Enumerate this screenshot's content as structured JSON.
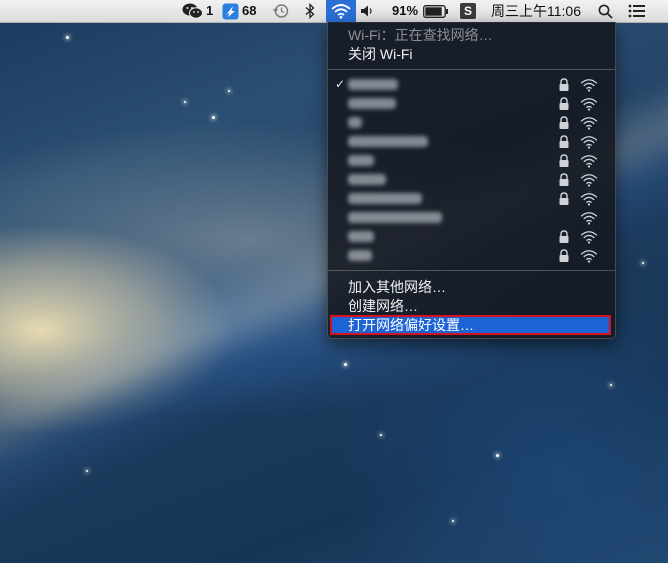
{
  "menubar": {
    "wechat": {
      "icon": "wechat-icon",
      "count": "1"
    },
    "app_badge": {
      "icon": "app-update-icon",
      "count": "68"
    },
    "time_machine_icon": "time-machine-icon",
    "bluetooth_icon": "bluetooth-icon",
    "wifi_icon": "wifi-icon",
    "volume_icon": "volume-icon",
    "battery": {
      "percent": "91%",
      "icon": "battery-icon",
      "level": 0.91
    },
    "input_method": {
      "icon": "input-method-icon",
      "label": "S"
    },
    "clock": "周三上午11:06",
    "spotlight_icon": "spotlight-search-icon",
    "notification_icon": "notification-center-icon"
  },
  "wifi_menu": {
    "status": "Wi-Fi：正在查找网络…",
    "toggle": "关闭 Wi-Fi",
    "networks": [
      {
        "locked": true,
        "connected": true
      },
      {
        "locked": true,
        "connected": false
      },
      {
        "locked": true,
        "connected": false
      },
      {
        "locked": true,
        "connected": false
      },
      {
        "locked": true,
        "connected": false
      },
      {
        "locked": true,
        "connected": false
      },
      {
        "locked": true,
        "connected": false
      },
      {
        "locked": false,
        "connected": false
      },
      {
        "locked": true,
        "connected": false
      },
      {
        "locked": true,
        "connected": false
      }
    ],
    "join_other": "加入其他网络…",
    "create": "创建网络…",
    "open_prefs": "打开网络偏好设置…"
  },
  "colors": {
    "highlight": "#1c64d6",
    "annotation_border": "#d6121f",
    "menubar_active": "#2a6fd6"
  }
}
